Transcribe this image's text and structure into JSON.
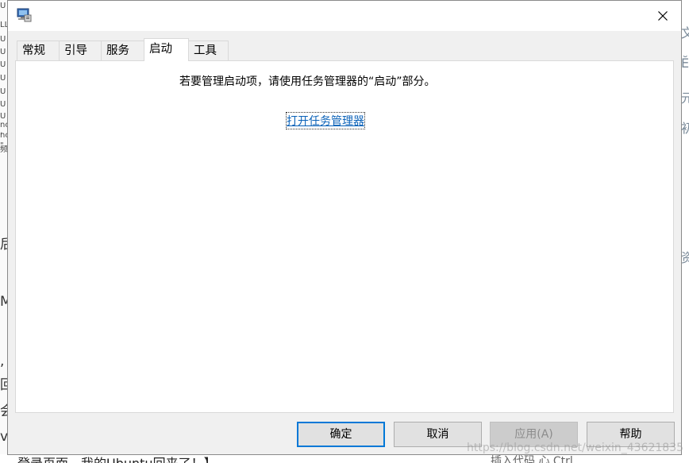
{
  "background": {
    "left_fragments": [
      "U",
      "LL",
      "U",
      "U",
      "U",
      "U",
      "U",
      "U",
      "U",
      "nc",
      "nc",
      "\"",
      ",",
      "频"
    ],
    "left_big_fragments": [
      "后",
      "M",
      ",",
      "回",
      "会",
      "v"
    ],
    "right_fragments": [
      "文",
      "Ӗ",
      "元",
      "初",
      "资"
    ],
    "bottom_text": "登录页面，我的Ubuntu回来了！】",
    "bottom_right_text": "插入代码      心      Ctrl"
  },
  "dialog": {
    "tabs": [
      {
        "label": "常规",
        "active": false
      },
      {
        "label": "引导",
        "active": false
      },
      {
        "label": "服务",
        "active": false
      },
      {
        "label": "启动",
        "active": true
      },
      {
        "label": "工具",
        "active": false
      }
    ],
    "message": "若要管理启动项，请使用任务管理器的“启动”部分。",
    "link": "打开任务管理器",
    "buttons": {
      "ok": "确定",
      "cancel": "取消",
      "apply": "应用(A)",
      "help": "帮助"
    }
  },
  "watermark": "https://blog.csdn.net/weixin_43621835",
  "colors": {
    "accent": "#0078d7",
    "link": "#0b62b8",
    "dialog_bg": "#f0f0f0"
  }
}
